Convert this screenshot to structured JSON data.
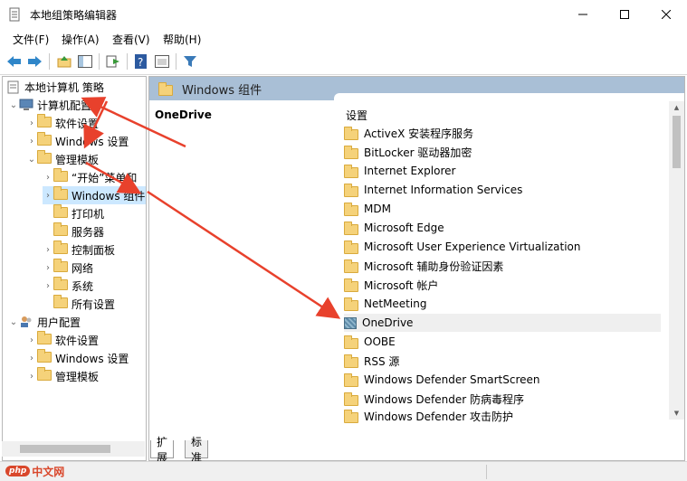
{
  "window": {
    "title": "本地组策略编辑器",
    "minimize_icon": "minimize-icon",
    "maximize_icon": "maximize-icon",
    "close_icon": "close-icon"
  },
  "menu": [
    "文件(F)",
    "操作(A)",
    "查看(V)",
    "帮助(H)"
  ],
  "tree": {
    "root": "本地计算机 策略",
    "items": [
      {
        "label": "计算机配置",
        "icon": "computer-icon"
      },
      {
        "label": "软件设置",
        "icon": "folder-icon"
      },
      {
        "label": "Windows 设置",
        "icon": "folder-icon"
      },
      {
        "label": "管理模板",
        "icon": "folder-icon"
      },
      {
        "label": "“开始”菜单和",
        "icon": "folder-icon"
      },
      {
        "label": "Windows 组件",
        "icon": "folder-icon"
      },
      {
        "label": "打印机",
        "icon": "folder-icon"
      },
      {
        "label": "服务器",
        "icon": "folder-icon"
      },
      {
        "label": "控制面板",
        "icon": "folder-icon"
      },
      {
        "label": "网络",
        "icon": "folder-icon"
      },
      {
        "label": "系统",
        "icon": "folder-icon"
      },
      {
        "label": "所有设置",
        "icon": "settings-folder-icon"
      },
      {
        "label": "用户配置",
        "icon": "users-icon"
      },
      {
        "label": "软件设置",
        "icon": "folder-icon"
      },
      {
        "label": "Windows 设置",
        "icon": "folder-icon"
      },
      {
        "label": "管理模板",
        "icon": "folder-icon"
      }
    ]
  },
  "right": {
    "header_title": "Windows 组件",
    "description_title": "OneDrive",
    "list_header": "设置",
    "items": [
      "ActiveX 安装程序服务",
      "BitLocker 驱动器加密",
      "Internet Explorer",
      "Internet Information Services",
      "MDM",
      "Microsoft Edge",
      "Microsoft User Experience Virtualization",
      "Microsoft 辅助身份验证因素",
      "Microsoft 帐户",
      "NetMeeting",
      "OneDrive",
      "OOBE",
      "RSS 源",
      "Windows Defender SmartScreen",
      "Windows Defender 防病毒程序",
      "Windows Defender 攻击防护"
    ],
    "selected_item": "OneDrive"
  },
  "tabs": [
    "扩展",
    "标准"
  ],
  "watermark": {
    "badge": "php",
    "text": "中文网"
  },
  "colors": {
    "header_bar": "#a9bfd6",
    "annotation_arrow": "#e8412c",
    "selection": "#cce8ff"
  }
}
